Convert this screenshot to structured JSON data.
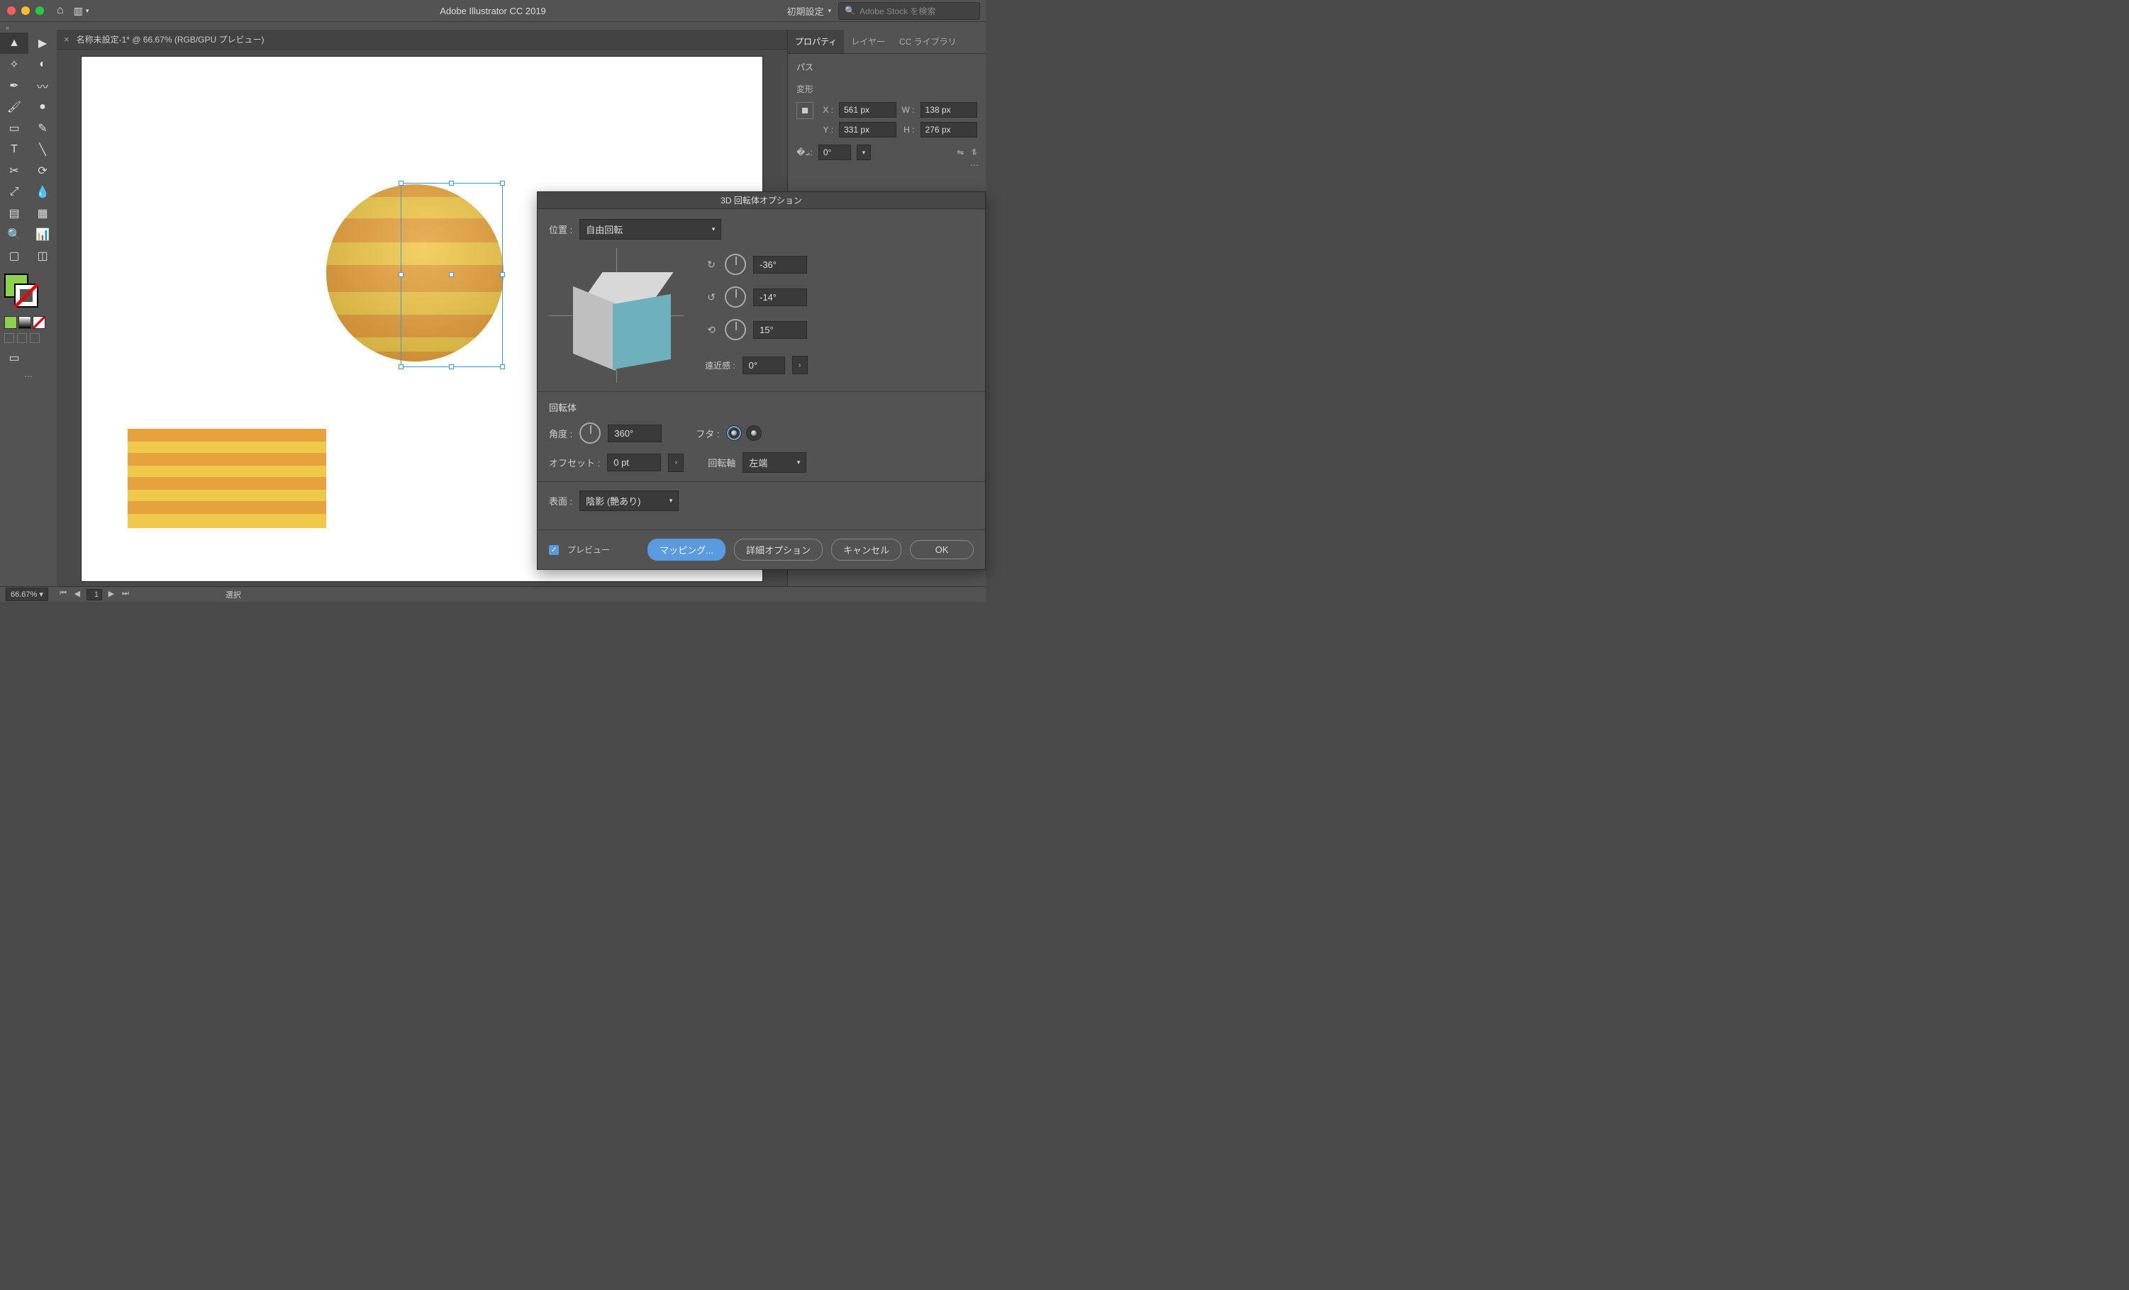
{
  "titlebar": {
    "app_title": "Adobe Illustrator CC 2019",
    "preset_label": "初期設定",
    "search_placeholder": "Adobe Stock を検索"
  },
  "doc": {
    "tab_label": "名称未設定-1* @ 66.67% (RGB/GPU プレビュー)"
  },
  "panels": {
    "tabs": {
      "properties": "プロパティ",
      "layers": "レイヤー",
      "cc": "CC ライブラリ"
    },
    "path_label": "パス",
    "transform_label": "変形",
    "x": "561 px",
    "y": "331 px",
    "w": "138 px",
    "h": "276 px",
    "angle": "0°"
  },
  "dialog": {
    "title": "3D 回転体オプション",
    "position_label": "位置 :",
    "position_value": "自由回転",
    "rot_x": "-36°",
    "rot_y": "-14°",
    "rot_z": "15°",
    "persp_label": "遠近感 :",
    "persp_value": "0°",
    "revolve_header": "回転体",
    "angle_label": "角度 :",
    "angle_value": "360°",
    "cap_label": "フタ :",
    "offset_label": "オフセット :",
    "offset_value": "0 pt",
    "axis_label": "回転軸",
    "axis_value": "左端",
    "surface_label": "表面 :",
    "surface_value": "陰影 (艶あり)",
    "preview_label": "プレビュー",
    "mapping_btn": "マッピング...",
    "more_btn": "詳細オプション",
    "cancel_btn": "キャンセル",
    "ok_btn": "OK"
  },
  "statusbar": {
    "zoom": "66.67%",
    "artboard": "1",
    "selection_label": "選択"
  }
}
